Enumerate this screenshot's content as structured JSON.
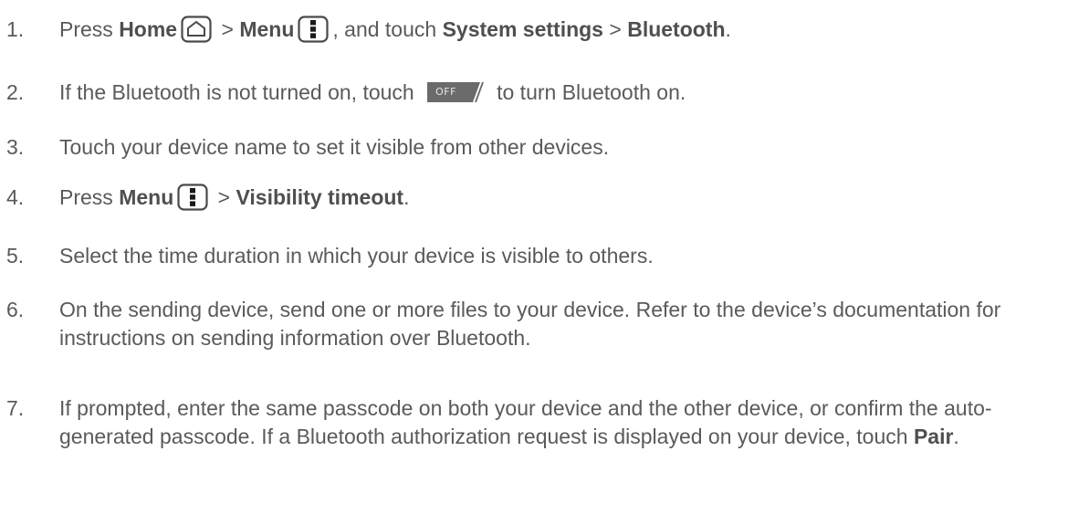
{
  "steps": [
    {
      "number": "1.",
      "parts": [
        "Press ",
        "Home",
        " > ",
        "Menu",
        ", and touch ",
        "System settings",
        " > ",
        "Bluetooth",
        "."
      ]
    },
    {
      "number": "2.",
      "parts": [
        "If the Bluetooth is not turned on, touch ",
        "to turn Bluetooth on."
      ],
      "toggle_label": "OFF"
    },
    {
      "number": "3.",
      "text": "Touch your device name to set it visible from other devices."
    },
    {
      "number": "4.",
      "parts": [
        "Press ",
        "Menu",
        " > ",
        "Visibility timeout",
        "."
      ]
    },
    {
      "number": "5.",
      "text": "Select the time duration in which your device is visible to others."
    },
    {
      "number": "6.",
      "text": "On the sending device, send one or more files to your device. Refer to the device’s documentation for instructions on sending information over Bluetooth."
    },
    {
      "number": "7.",
      "parts": [
        "If prompted, enter the same passcode on both your device and the other device, or confirm the auto-generated passcode. If a Bluetooth authorization request is displayed on your device, touch ",
        "Pair",
        "."
      ]
    }
  ],
  "icons": {
    "home": "home-icon",
    "menu": "menu-icon"
  },
  "colors": {
    "text": "#5a5a5a",
    "toggle_bg": "#6b6b6b"
  }
}
